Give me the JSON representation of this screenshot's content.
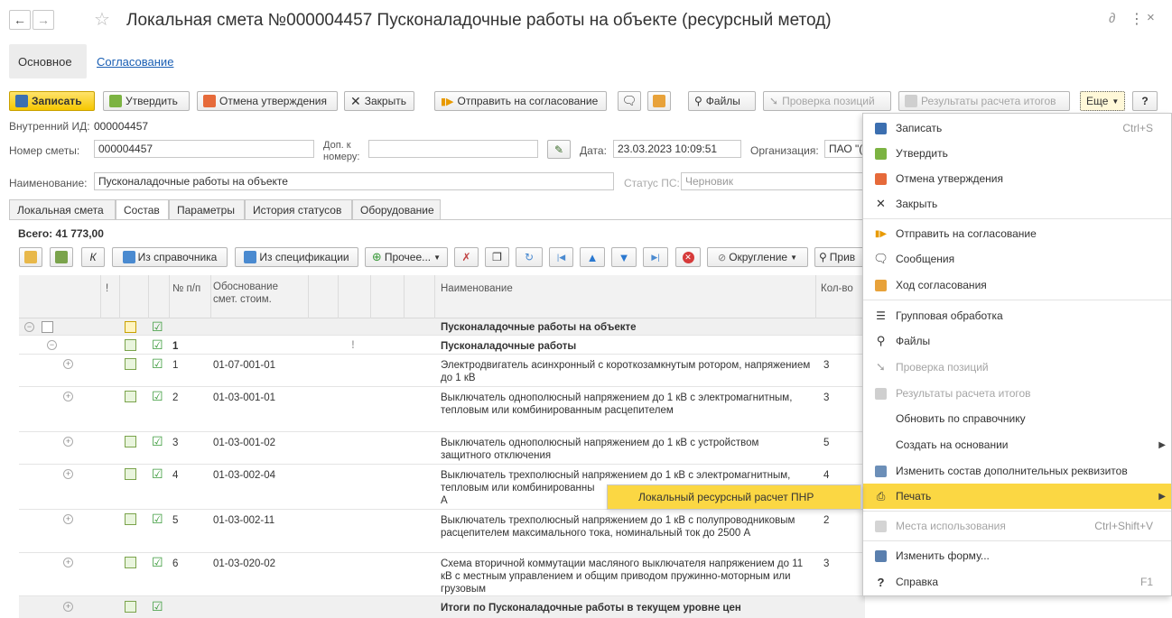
{
  "window": {
    "title": "Локальная смета №000004457 Пусконаладочные работы на объекте (ресурсный метод)"
  },
  "form_tabs": [
    {
      "label": "Основное"
    },
    {
      "label": "Согласование"
    }
  ],
  "toolbar": {
    "save": "Записать",
    "approve": "Утвердить",
    "cancel_approval": "Отмена утверждения",
    "close": "Закрыть",
    "send": "Отправить на согласование",
    "files": "Файлы",
    "check": "Проверка позиций",
    "results": "Результаты расчета итогов",
    "more": "Еще",
    "help": "?"
  },
  "header": {
    "internal_id_label": "Внутренний ИД:",
    "internal_id": "000004457",
    "estimate_number_label": "Номер сметы:",
    "estimate_number": "000004457",
    "addnum_label_1": "Доп. к",
    "addnum_label_2": "номеру:",
    "addnum_value": "",
    "date_label": "Дата:",
    "date_value": "23.03.2023 10:09:51",
    "org_label": "Организация:",
    "org_value": "ПАО \"(",
    "name_label": "Наименование:",
    "name_value": "Пусконаладочные работы на объекте",
    "status_label": "Статус ПС:",
    "status_value": "Черновик"
  },
  "content_tabs": [
    {
      "label": "Локальная смета"
    },
    {
      "label": "Состав"
    },
    {
      "label": "Параметры"
    },
    {
      "label": "История статусов"
    },
    {
      "label": "Оборудование"
    }
  ],
  "total": "Всего: 41 773,00",
  "table_toolbar": {
    "k": "К",
    "from_ref": "Из справочника",
    "from_spec": "Из спецификации",
    "other": "Прочее...",
    "rounding": "Округление",
    "attach": "Прив"
  },
  "grid": {
    "headers": {
      "excl": "!",
      "num": "№ п/п",
      "basis_1": "Обоснование",
      "basis_2": "смет. стоим.",
      "name": "Наименование",
      "qty": "Кол-во"
    },
    "rows": [
      {
        "num": "",
        "code": "",
        "name": "Пусконаладочные работы на объекте",
        "qty": "",
        "excl": ""
      },
      {
        "num": "1",
        "code": "",
        "name": "Пусконаладочные работы",
        "qty": "",
        "excl": "!"
      },
      {
        "num": "1",
        "code": "01-07-001-01",
        "name": "Электродвигатель асинхронный с короткозамкнутым ротором, напряжением до 1 кВ",
        "qty": "3",
        "excl": ""
      },
      {
        "num": "2",
        "code": "01-03-001-01",
        "name": "Выключатель однополюсный напряжением до 1 кВ с электромагнитным, тепловым или комбинированным расцепителем",
        "qty": "3",
        "excl": ""
      },
      {
        "num": "3",
        "code": "01-03-001-02",
        "name": "Выключатель однополюсный напряжением до 1 кВ с устройством защитного отключения",
        "qty": "5",
        "excl": ""
      },
      {
        "num": "4",
        "code": "01-03-002-04",
        "name": "Выключатель трехполюсный напряжением до 1 кВ с электромагнитным, тепловым или комбинированны",
        "name_tail": "А",
        "qty": "4",
        "excl": ""
      },
      {
        "num": "5",
        "code": "01-03-002-11",
        "name": "Выключатель трехполюсный напряжением до 1 кВ с полупроводниковым расцепителем максимального тока, номинальный ток до 2500 А",
        "qty": "2",
        "excl": ""
      },
      {
        "num": "6",
        "code": "01-03-020-02",
        "name": "Схема вторичной коммутации масляного выключателя напряжением до 11 кВ с местным управлением и общим приводом пружинно-моторным или грузовым",
        "qty": "3",
        "excl": ""
      },
      {
        "num": "",
        "code": "",
        "name": "Итоги по Пусконаладочные работы в текущем уровне цен",
        "qty": "",
        "excl": ""
      }
    ]
  },
  "menu": {
    "items": [
      {
        "label": "Записать",
        "shortcut": "Ctrl+S",
        "icon": "floppy-icon"
      },
      {
        "label": "Утвердить",
        "shortcut": "",
        "icon": "approve-icon"
      },
      {
        "label": "Отмена утверждения",
        "shortcut": "",
        "icon": "cancel-approve-icon"
      },
      {
        "label": "Закрыть",
        "shortcut": "",
        "icon": "close-icon"
      },
      {
        "label": "Отправить на согласование",
        "shortcut": "",
        "icon": "send-icon"
      },
      {
        "label": "Сообщения",
        "shortcut": "",
        "icon": "message-icon"
      },
      {
        "label": "Ход согласования",
        "shortcut": "",
        "icon": "workflow-icon"
      },
      {
        "label": "Групповая обработка",
        "shortcut": "",
        "icon": "group-icon"
      },
      {
        "label": "Файлы",
        "shortcut": "",
        "icon": "paperclip-icon"
      },
      {
        "label": "Проверка позиций",
        "shortcut": "",
        "icon": "check-positions-icon"
      },
      {
        "label": "Результаты расчета итогов",
        "shortcut": "",
        "icon": "results-icon"
      },
      {
        "label": "Обновить по справочнику",
        "shortcut": "",
        "icon": ""
      },
      {
        "label": "Создать на основании",
        "shortcut": "",
        "icon": ""
      },
      {
        "label": "Изменить состав дополнительных реквизитов",
        "shortcut": "",
        "icon": "attributes-icon"
      },
      {
        "label": "Печать",
        "shortcut": "",
        "icon": "print-icon"
      },
      {
        "label": "Места использования",
        "shortcut": "Ctrl+Shift+V",
        "icon": "usage-icon"
      },
      {
        "label": "Изменить форму...",
        "shortcut": "",
        "icon": "form-icon"
      },
      {
        "label": "Справка",
        "shortcut": "F1",
        "icon": "help-icon"
      }
    ],
    "submenu_print": "Локальный ресурсный расчет ПНР"
  },
  "colors": {
    "accent_yellow": "#fbd743",
    "check_green": "#3a9a3a",
    "link_blue": "#1a5fb4"
  }
}
